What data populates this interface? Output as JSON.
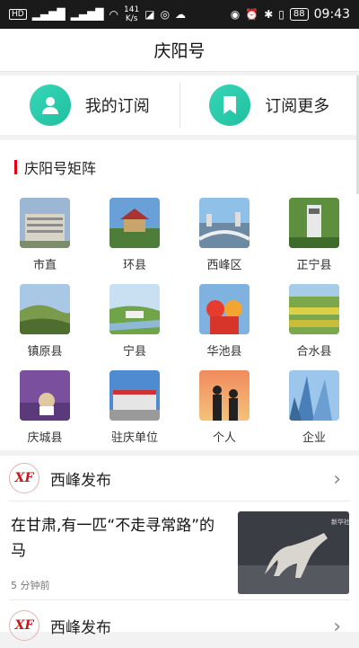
{
  "status_bar": {
    "left_chips": [
      "HD",
      "4G",
      "46",
      "HD"
    ],
    "net_speed": "141\nK/s",
    "battery": "88",
    "time": "09:43"
  },
  "header": {
    "title": "庆阳号"
  },
  "subscribe": {
    "my_subscriptions": "我的订阅",
    "subscribe_more": "订阅更多"
  },
  "matrix": {
    "title": "庆阳号矩阵",
    "accent_color": "#e60012",
    "items": [
      {
        "label": "市直"
      },
      {
        "label": "环县"
      },
      {
        "label": "西峰区"
      },
      {
        "label": "正宁县"
      },
      {
        "label": "镇原县"
      },
      {
        "label": "宁县"
      },
      {
        "label": "华池县"
      },
      {
        "label": "合水县"
      },
      {
        "label": "庆城县"
      },
      {
        "label": "驻庆单位"
      },
      {
        "label": "个人"
      },
      {
        "label": "企业"
      }
    ]
  },
  "news": {
    "source1": {
      "logo_text": "XF",
      "name": "西峰发布"
    },
    "article": {
      "title": "在甘肃,有一匹“不走寻常路”的马",
      "time": "5 分钟前",
      "image_caption": "新华社"
    },
    "source2": {
      "logo_text": "XF",
      "name": "西峰发布"
    }
  }
}
